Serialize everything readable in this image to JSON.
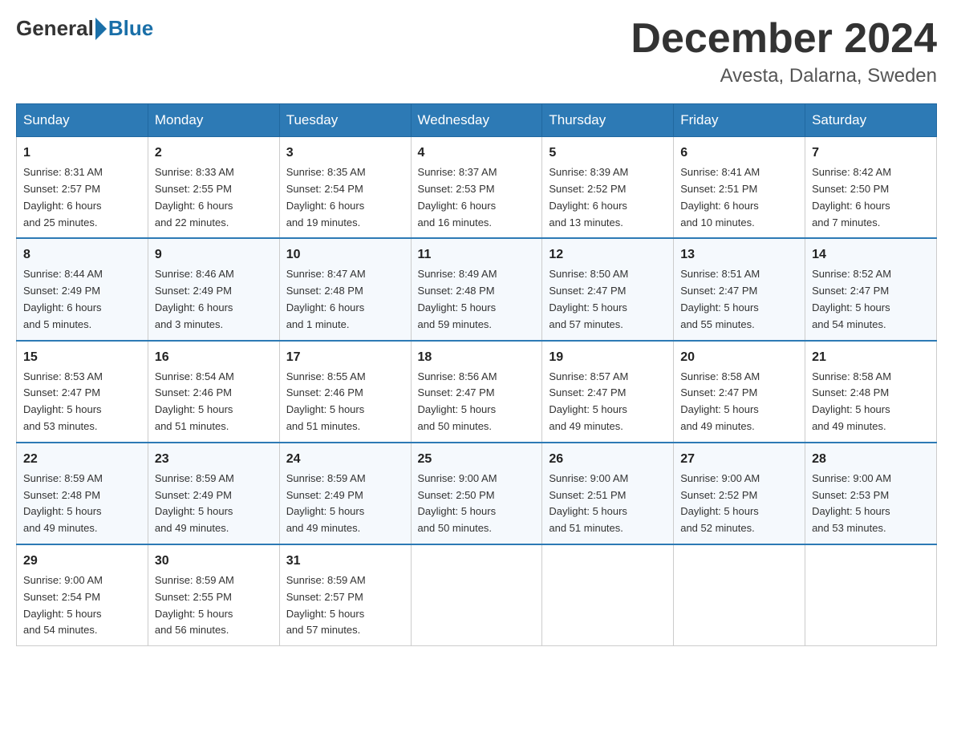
{
  "header": {
    "logo_general": "General",
    "logo_blue": "Blue",
    "month_title": "December 2024",
    "location": "Avesta, Dalarna, Sweden"
  },
  "days_of_week": [
    "Sunday",
    "Monday",
    "Tuesday",
    "Wednesday",
    "Thursday",
    "Friday",
    "Saturday"
  ],
  "weeks": [
    [
      {
        "day": "1",
        "sunrise": "8:31 AM",
        "sunset": "2:57 PM",
        "daylight": "6 hours and 25 minutes."
      },
      {
        "day": "2",
        "sunrise": "8:33 AM",
        "sunset": "2:55 PM",
        "daylight": "6 hours and 22 minutes."
      },
      {
        "day": "3",
        "sunrise": "8:35 AM",
        "sunset": "2:54 PM",
        "daylight": "6 hours and 19 minutes."
      },
      {
        "day": "4",
        "sunrise": "8:37 AM",
        "sunset": "2:53 PM",
        "daylight": "6 hours and 16 minutes."
      },
      {
        "day": "5",
        "sunrise": "8:39 AM",
        "sunset": "2:52 PM",
        "daylight": "6 hours and 13 minutes."
      },
      {
        "day": "6",
        "sunrise": "8:41 AM",
        "sunset": "2:51 PM",
        "daylight": "6 hours and 10 minutes."
      },
      {
        "day": "7",
        "sunrise": "8:42 AM",
        "sunset": "2:50 PM",
        "daylight": "6 hours and 7 minutes."
      }
    ],
    [
      {
        "day": "8",
        "sunrise": "8:44 AM",
        "sunset": "2:49 PM",
        "daylight": "6 hours and 5 minutes."
      },
      {
        "day": "9",
        "sunrise": "8:46 AM",
        "sunset": "2:49 PM",
        "daylight": "6 hours and 3 minutes."
      },
      {
        "day": "10",
        "sunrise": "8:47 AM",
        "sunset": "2:48 PM",
        "daylight": "6 hours and 1 minute."
      },
      {
        "day": "11",
        "sunrise": "8:49 AM",
        "sunset": "2:48 PM",
        "daylight": "5 hours and 59 minutes."
      },
      {
        "day": "12",
        "sunrise": "8:50 AM",
        "sunset": "2:47 PM",
        "daylight": "5 hours and 57 minutes."
      },
      {
        "day": "13",
        "sunrise": "8:51 AM",
        "sunset": "2:47 PM",
        "daylight": "5 hours and 55 minutes."
      },
      {
        "day": "14",
        "sunrise": "8:52 AM",
        "sunset": "2:47 PM",
        "daylight": "5 hours and 54 minutes."
      }
    ],
    [
      {
        "day": "15",
        "sunrise": "8:53 AM",
        "sunset": "2:47 PM",
        "daylight": "5 hours and 53 minutes."
      },
      {
        "day": "16",
        "sunrise": "8:54 AM",
        "sunset": "2:46 PM",
        "daylight": "5 hours and 51 minutes."
      },
      {
        "day": "17",
        "sunrise": "8:55 AM",
        "sunset": "2:46 PM",
        "daylight": "5 hours and 51 minutes."
      },
      {
        "day": "18",
        "sunrise": "8:56 AM",
        "sunset": "2:47 PM",
        "daylight": "5 hours and 50 minutes."
      },
      {
        "day": "19",
        "sunrise": "8:57 AM",
        "sunset": "2:47 PM",
        "daylight": "5 hours and 49 minutes."
      },
      {
        "day": "20",
        "sunrise": "8:58 AM",
        "sunset": "2:47 PM",
        "daylight": "5 hours and 49 minutes."
      },
      {
        "day": "21",
        "sunrise": "8:58 AM",
        "sunset": "2:48 PM",
        "daylight": "5 hours and 49 minutes."
      }
    ],
    [
      {
        "day": "22",
        "sunrise": "8:59 AM",
        "sunset": "2:48 PM",
        "daylight": "5 hours and 49 minutes."
      },
      {
        "day": "23",
        "sunrise": "8:59 AM",
        "sunset": "2:49 PM",
        "daylight": "5 hours and 49 minutes."
      },
      {
        "day": "24",
        "sunrise": "8:59 AM",
        "sunset": "2:49 PM",
        "daylight": "5 hours and 49 minutes."
      },
      {
        "day": "25",
        "sunrise": "9:00 AM",
        "sunset": "2:50 PM",
        "daylight": "5 hours and 50 minutes."
      },
      {
        "day": "26",
        "sunrise": "9:00 AM",
        "sunset": "2:51 PM",
        "daylight": "5 hours and 51 minutes."
      },
      {
        "day": "27",
        "sunrise": "9:00 AM",
        "sunset": "2:52 PM",
        "daylight": "5 hours and 52 minutes."
      },
      {
        "day": "28",
        "sunrise": "9:00 AM",
        "sunset": "2:53 PM",
        "daylight": "5 hours and 53 minutes."
      }
    ],
    [
      {
        "day": "29",
        "sunrise": "9:00 AM",
        "sunset": "2:54 PM",
        "daylight": "5 hours and 54 minutes."
      },
      {
        "day": "30",
        "sunrise": "8:59 AM",
        "sunset": "2:55 PM",
        "daylight": "5 hours and 56 minutes."
      },
      {
        "day": "31",
        "sunrise": "8:59 AM",
        "sunset": "2:57 PM",
        "daylight": "5 hours and 57 minutes."
      },
      null,
      null,
      null,
      null
    ]
  ],
  "labels": {
    "sunrise": "Sunrise:",
    "sunset": "Sunset:",
    "daylight": "Daylight:"
  }
}
